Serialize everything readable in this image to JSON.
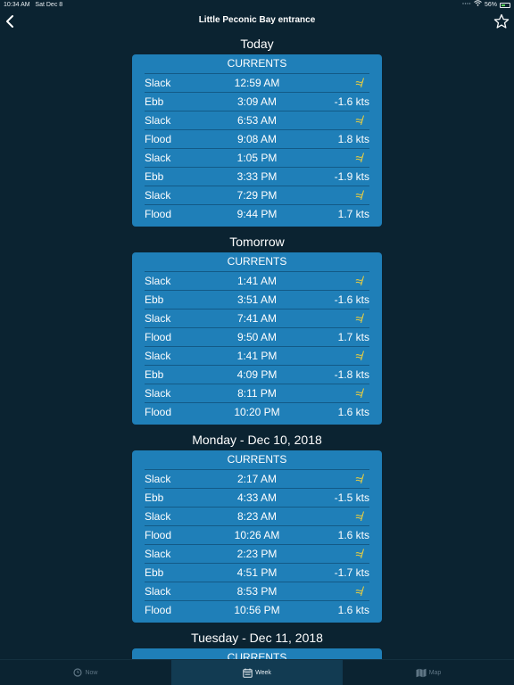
{
  "status_bar": {
    "time": "10:34 AM",
    "date": "Sat Dec 8",
    "battery": "56%",
    "battery_level": 0.56
  },
  "header": {
    "title": "Little Peconic Bay entrance"
  },
  "days": [
    {
      "heading": "Today",
      "section_title": "CURRENTS",
      "rows": [
        {
          "type": "Slack",
          "time": "12:59 AM",
          "value": "≉"
        },
        {
          "type": "Ebb",
          "time": "3:09 AM",
          "value": "-1.6 kts"
        },
        {
          "type": "Slack",
          "time": "6:53 AM",
          "value": "≉"
        },
        {
          "type": "Flood",
          "time": "9:08 AM",
          "value": "1.8 kts"
        },
        {
          "type": "Slack",
          "time": "1:05 PM",
          "value": "≉"
        },
        {
          "type": "Ebb",
          "time": "3:33 PM",
          "value": "-1.9 kts"
        },
        {
          "type": "Slack",
          "time": "7:29 PM",
          "value": "≉"
        },
        {
          "type": "Flood",
          "time": "9:44 PM",
          "value": "1.7 kts"
        }
      ]
    },
    {
      "heading": "Tomorrow",
      "section_title": "CURRENTS",
      "rows": [
        {
          "type": "Slack",
          "time": "1:41 AM",
          "value": "≉"
        },
        {
          "type": "Ebb",
          "time": "3:51 AM",
          "value": "-1.6 kts"
        },
        {
          "type": "Slack",
          "time": "7:41 AM",
          "value": "≉"
        },
        {
          "type": "Flood",
          "time": "9:50 AM",
          "value": "1.7 kts"
        },
        {
          "type": "Slack",
          "time": "1:41 PM",
          "value": "≉"
        },
        {
          "type": "Ebb",
          "time": "4:09 PM",
          "value": "-1.8 kts"
        },
        {
          "type": "Slack",
          "time": "8:11 PM",
          "value": "≉"
        },
        {
          "type": "Flood",
          "time": "10:20 PM",
          "value": "1.6 kts"
        }
      ]
    },
    {
      "heading": "Monday - Dec 10, 2018",
      "section_title": "CURRENTS",
      "rows": [
        {
          "type": "Slack",
          "time": "2:17 AM",
          "value": "≉"
        },
        {
          "type": "Ebb",
          "time": "4:33 AM",
          "value": "-1.5 kts"
        },
        {
          "type": "Slack",
          "time": "8:23 AM",
          "value": "≉"
        },
        {
          "type": "Flood",
          "time": "10:26 AM",
          "value": "1.6 kts"
        },
        {
          "type": "Slack",
          "time": "2:23 PM",
          "value": "≉"
        },
        {
          "type": "Ebb",
          "time": "4:51 PM",
          "value": "-1.7 kts"
        },
        {
          "type": "Slack",
          "time": "8:53 PM",
          "value": "≉"
        },
        {
          "type": "Flood",
          "time": "10:56 PM",
          "value": "1.6 kts"
        }
      ]
    },
    {
      "heading": "Tuesday - Dec 11, 2018",
      "section_title": "CURRENTS",
      "rows": []
    }
  ],
  "tabs": [
    {
      "label": "Now",
      "icon": "clock-icon",
      "active": false
    },
    {
      "label": "Week",
      "icon": "calendar-icon",
      "active": true
    },
    {
      "label": "Map",
      "icon": "map-icon",
      "active": false
    }
  ],
  "colors": {
    "background": "#0b2331",
    "card": "#1f7fb8",
    "slack_icon": "#f2d13b",
    "tab_active": "#123b52"
  }
}
